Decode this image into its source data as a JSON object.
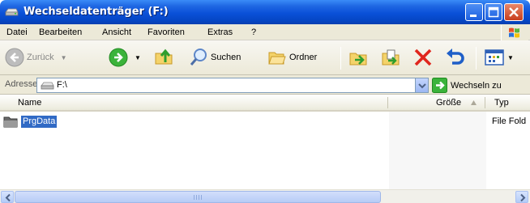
{
  "window": {
    "title": "Wechseldatenträger (F:)",
    "controls": {
      "minimize": "_",
      "maximize": "□",
      "close": "✕"
    }
  },
  "menubar": {
    "items": [
      "Datei",
      "Bearbeiten",
      "Ansicht",
      "Favoriten",
      "Extras",
      "?"
    ]
  },
  "toolbar": {
    "back_label": "Zurück",
    "search_label": "Suchen",
    "folders_label": "Ordner"
  },
  "address": {
    "label": "Adresse",
    "value": "F:\\",
    "go_label": "Wechseln zu"
  },
  "list": {
    "columns": [
      "Name",
      "Größe",
      "Typ"
    ],
    "rows": [
      {
        "name": "PrgData",
        "size": "",
        "type": "File Fold"
      }
    ]
  },
  "colors": {
    "titlebar": "#0a50d8",
    "selection": "#316ac5",
    "chrome": "#ece9d8"
  }
}
